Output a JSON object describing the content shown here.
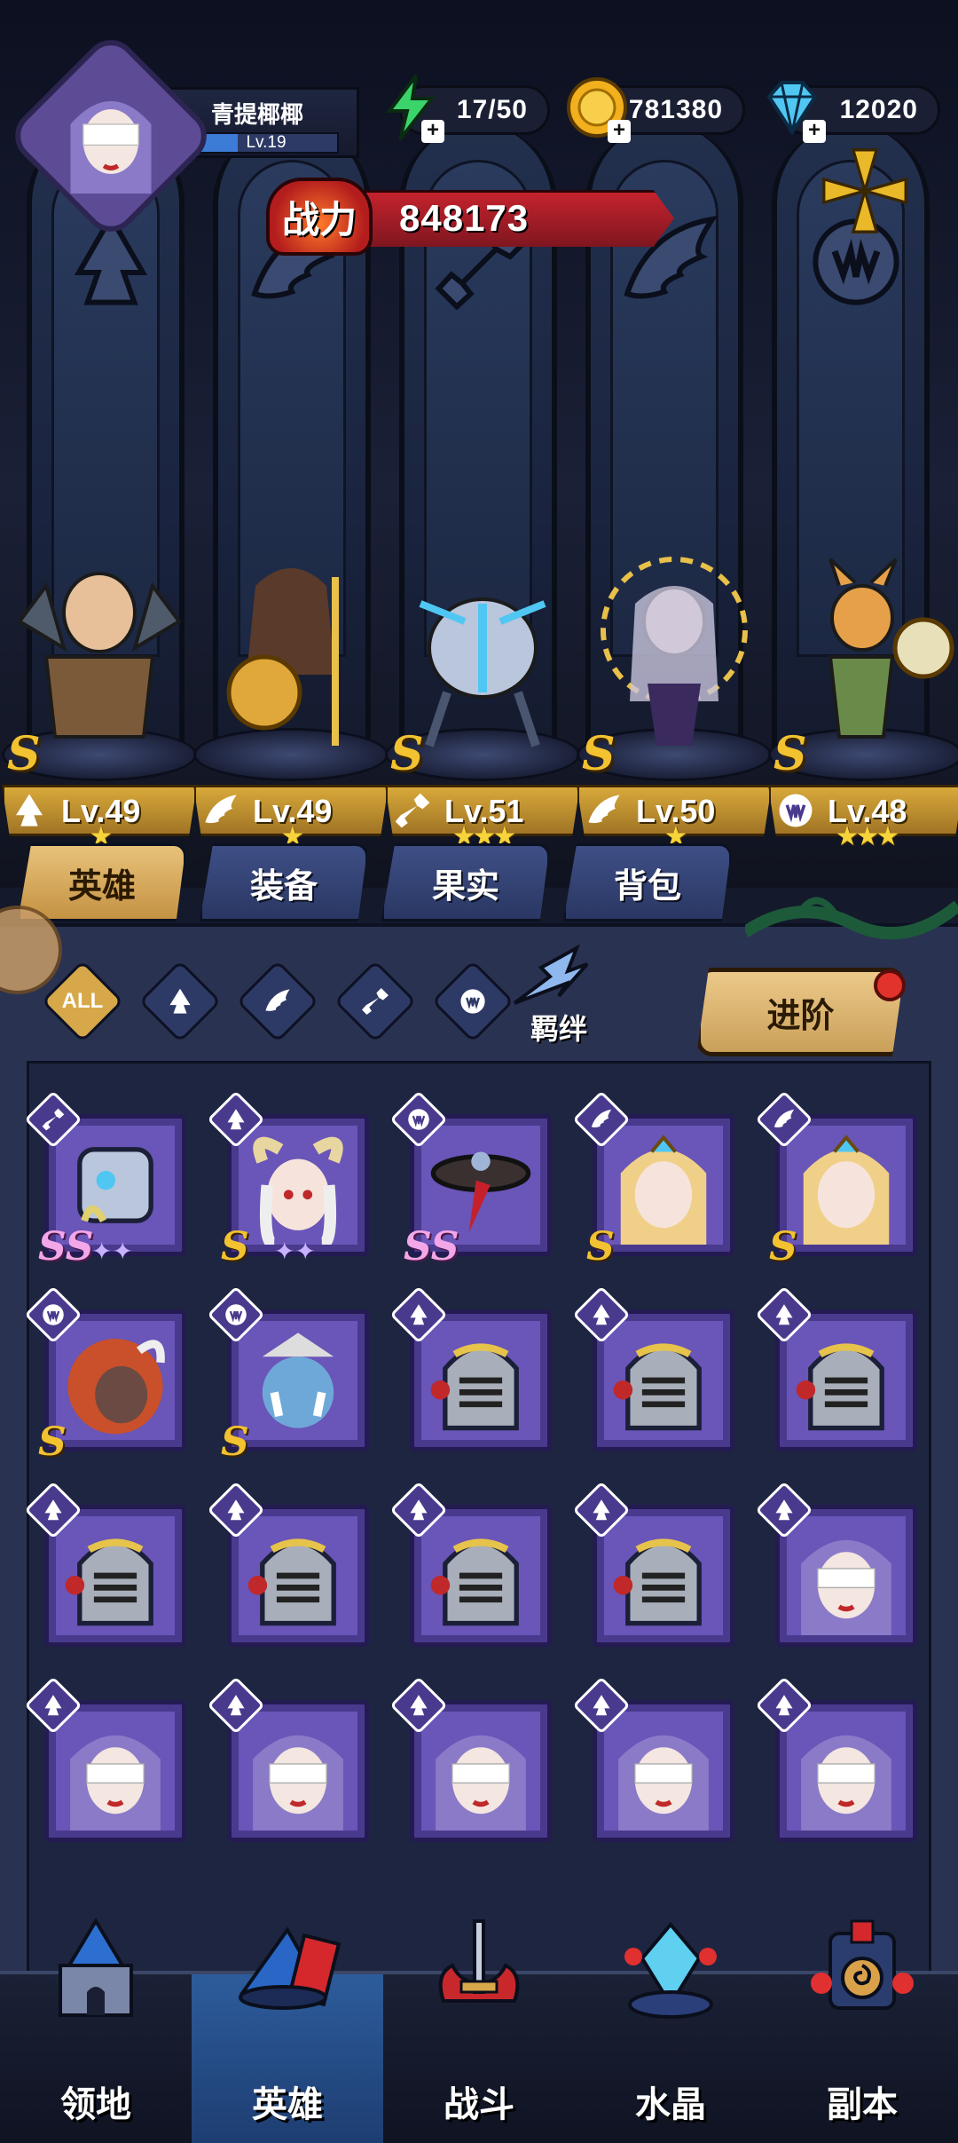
{
  "player": {
    "name": "青提椰椰",
    "level_label": "Lv.19",
    "level_progress": 0.3
  },
  "resources": {
    "stamina": "17/50",
    "gold": "781380",
    "diamonds": "12020"
  },
  "combat_power": {
    "badge": "战力",
    "value": "848173"
  },
  "lineup": [
    {
      "level": "Lv.49",
      "rank": "S",
      "stars": "★",
      "class_icon": "tank-class-icon"
    },
    {
      "level": "Lv.49",
      "rank": "",
      "stars": "★",
      "class_icon": "wing-class-icon"
    },
    {
      "level": "Lv.51",
      "rank": "S",
      "stars": "★★★",
      "class_icon": "wrench-class-icon"
    },
    {
      "level": "Lv.50",
      "rank": "S",
      "stars": "★",
      "class_icon": "wing-class-icon"
    },
    {
      "level": "Lv.48",
      "rank": "S",
      "stars": "★★★",
      "class_icon": "claw-class-icon"
    }
  ],
  "tabs": [
    {
      "label": "英雄",
      "active": true
    },
    {
      "label": "装备",
      "active": false
    },
    {
      "label": "果实",
      "active": false
    },
    {
      "label": "背包",
      "active": false
    }
  ],
  "filters": {
    "all_label": "ALL",
    "bond_label": "羁绊",
    "advance_label": "进阶"
  },
  "heroes": [
    {
      "rank": "SS",
      "stars": "✦✦",
      "cls": "wrench",
      "portrait": "mech"
    },
    {
      "rank": "S",
      "stars": "✦✦",
      "cls": "tank",
      "portrait": "horned-lady"
    },
    {
      "rank": "SS",
      "stars": "",
      "cls": "claw",
      "portrait": "ufo"
    },
    {
      "rank": "S",
      "stars": "",
      "cls": "wing",
      "portrait": "angel"
    },
    {
      "rank": "S",
      "stars": "",
      "cls": "wing",
      "portrait": "angel"
    },
    {
      "rank": "S",
      "stars": "",
      "cls": "claw",
      "portrait": "lion"
    },
    {
      "rank": "S",
      "stars": "",
      "cls": "claw",
      "portrait": "blue-orc"
    },
    {
      "rank": "",
      "stars": "",
      "cls": "tank",
      "portrait": "knight"
    },
    {
      "rank": "",
      "stars": "",
      "cls": "tank",
      "portrait": "knight"
    },
    {
      "rank": "",
      "stars": "",
      "cls": "tank",
      "portrait": "knight"
    },
    {
      "rank": "",
      "stars": "",
      "cls": "tank",
      "portrait": "knight"
    },
    {
      "rank": "",
      "stars": "",
      "cls": "tank",
      "portrait": "knight"
    },
    {
      "rank": "",
      "stars": "",
      "cls": "tank",
      "portrait": "knight"
    },
    {
      "rank": "",
      "stars": "",
      "cls": "tank",
      "portrait": "knight"
    },
    {
      "rank": "",
      "stars": "",
      "cls": "tank",
      "portrait": "nun"
    },
    {
      "rank": "",
      "stars": "",
      "cls": "tank",
      "portrait": "nun"
    },
    {
      "rank": "",
      "stars": "",
      "cls": "tank",
      "portrait": "nun"
    },
    {
      "rank": "",
      "stars": "",
      "cls": "tank",
      "portrait": "nun"
    },
    {
      "rank": "",
      "stars": "",
      "cls": "tank",
      "portrait": "nun"
    },
    {
      "rank": "",
      "stars": "",
      "cls": "tank",
      "portrait": "nun"
    }
  ],
  "nav": [
    {
      "label": "领地",
      "icon": "castle-icon",
      "active": false
    },
    {
      "label": "英雄",
      "icon": "hero-hat-icon",
      "active": true
    },
    {
      "label": "战斗",
      "icon": "sword-icon",
      "active": false
    },
    {
      "label": "水晶",
      "icon": "crystal-icon",
      "active": false
    },
    {
      "label": "副本",
      "icon": "dungeon-icon",
      "active": false
    }
  ]
}
